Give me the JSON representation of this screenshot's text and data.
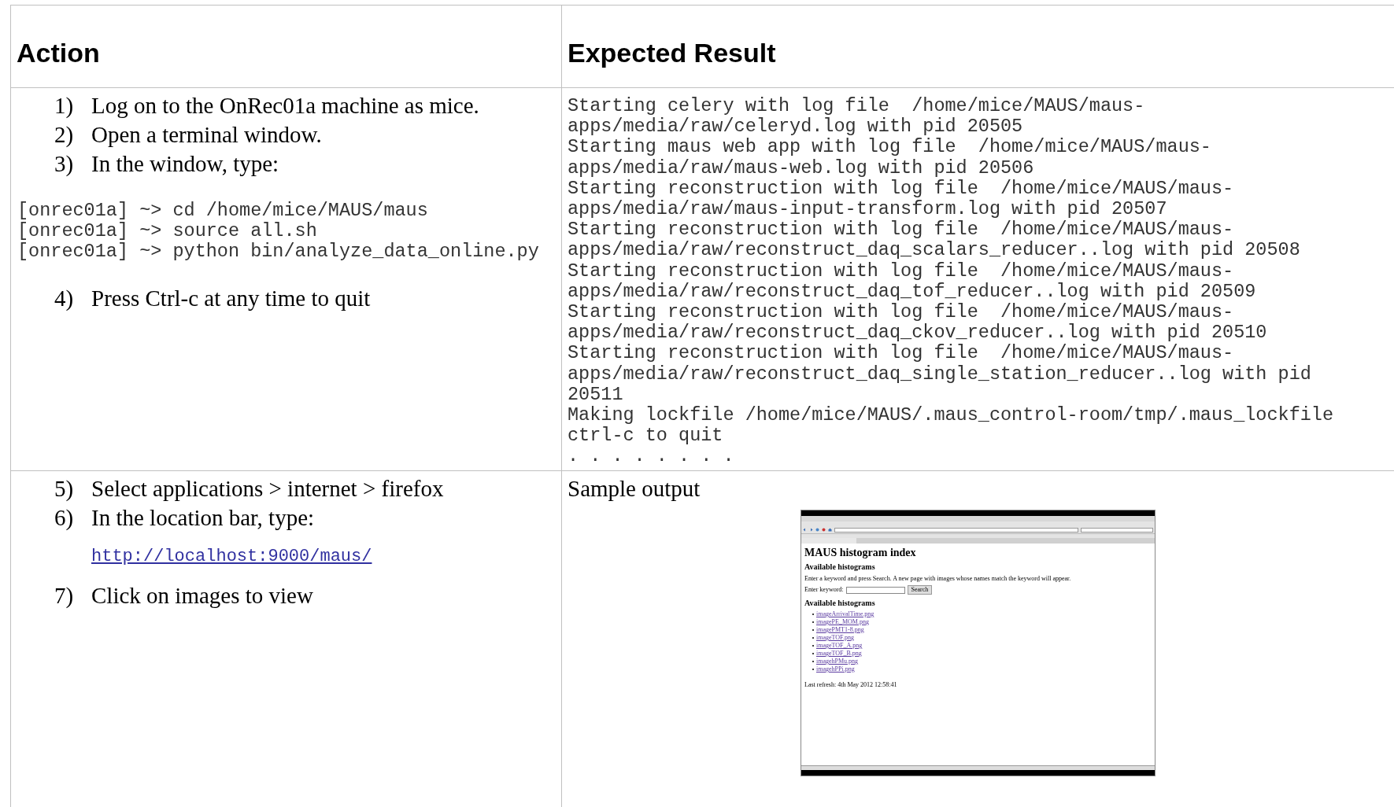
{
  "table": {
    "columns": [
      "Action",
      "Expected Result"
    ],
    "rows": [
      {
        "action": [
          {
            "kind": "step",
            "number": "1)",
            "text": "Log on to the OnRec01a machine as mice."
          },
          {
            "kind": "step",
            "number": "2)",
            "text": "Open a terminal window."
          },
          {
            "kind": "step",
            "number": "3)",
            "text": "In the window, type:"
          },
          {
            "kind": "code",
            "lines": [
              "[onrec01a] ~> cd /home/mice/MAUS/maus",
              "[onrec01a] ~> source all.sh",
              "[onrec01a] ~> python bin/analyze_data_online.py"
            ]
          },
          {
            "kind": "step",
            "number": "4)",
            "text": "Press Ctrl-c at any time to quit"
          }
        ],
        "result": [
          {
            "kind": "code",
            "lines": [
              "Starting celery with log file  /home/mice/MAUS/maus-",
              "apps/media/raw/celeryd.log with pid 20505",
              "Starting maus web app with log file  /home/mice/MAUS/maus-",
              "apps/media/raw/maus-web.log with pid 20506",
              "Starting reconstruction with log file  /home/mice/MAUS/maus-",
              "apps/media/raw/maus-input-transform.log with pid 20507",
              "Starting reconstruction with log file  /home/mice/MAUS/maus-",
              "apps/media/raw/reconstruct_daq_scalars_reducer..log with pid 20508",
              "Starting reconstruction with log file  /home/mice/MAUS/maus-",
              "apps/media/raw/reconstruct_daq_tof_reducer..log with pid 20509",
              "Starting reconstruction with log file  /home/mice/MAUS/maus-",
              "apps/media/raw/reconstruct_daq_ckov_reducer..log with pid 20510",
              "Starting reconstruction with log file  /home/mice/MAUS/maus-",
              "apps/media/raw/reconstruct_daq_single_station_reducer..log with pid",
              "20511",
              "Making lockfile /home/mice/MAUS/.maus_control-room/tmp/.maus_lockfile",
              "ctrl-c to quit",
              ". . . . . . . ."
            ]
          }
        ]
      },
      {
        "action": [
          {
            "kind": "step",
            "number": "5)",
            "text": "Select applications > internet > firefox"
          },
          {
            "kind": "step",
            "number": "6)",
            "text": "In the location bar, type:"
          },
          {
            "kind": "link",
            "text": "http://localhost:9000/maus/"
          },
          {
            "kind": "step",
            "number": "7)",
            "text": "Click on images to view"
          }
        ],
        "result": [
          {
            "kind": "text",
            "text": "Sample output"
          },
          {
            "kind": "screenshot",
            "page": {
              "title": "MAUS histogram index",
              "subtitle": "Available histograms",
              "intro": "Enter a keyword and press Search. A new page with images whose names match the keyword will appear.",
              "keyword_label": "Enter keyword:",
              "search_button": "Search",
              "list_heading": "Available histograms",
              "links": [
                "imageArrivalTime.png",
                "imagePE_MOM.png",
                "imagePMT1-8.png",
                "imageTOF.png",
                "imageTOF_A.png",
                "imageTOF_B.png",
                "imagehPMu.png",
                "imagehPPi.png"
              ],
              "refresh": "Last refresh: 4th May 2012 12:58:41"
            }
          }
        ]
      }
    ]
  }
}
